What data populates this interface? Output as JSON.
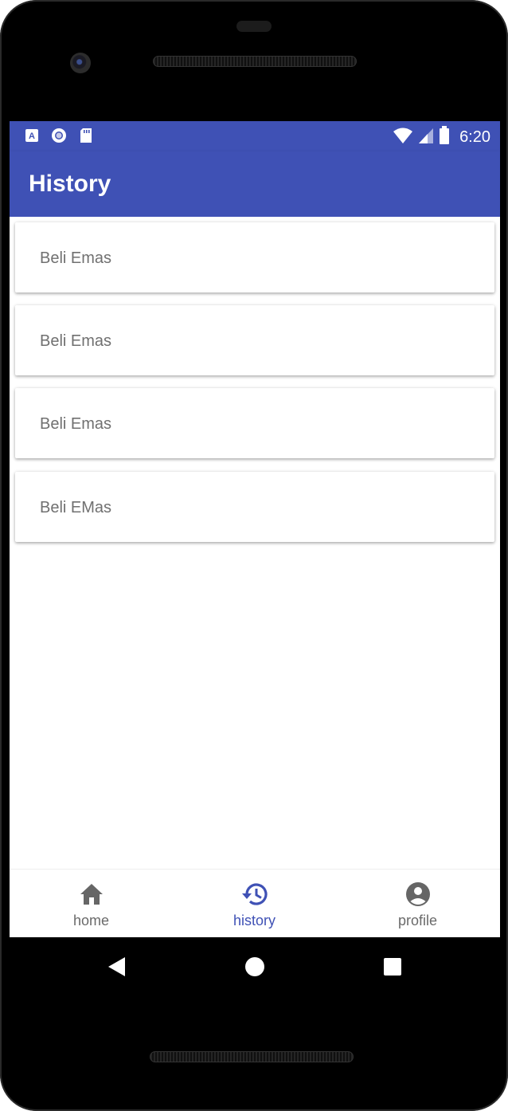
{
  "status_bar": {
    "time": "6:20",
    "left_icons": [
      "accessibility-a-icon",
      "circle-target-icon",
      "sd-card-icon"
    ],
    "right_icons": [
      "wifi-icon",
      "cell-signal-icon",
      "battery-icon"
    ]
  },
  "app_bar": {
    "title": "History"
  },
  "history": {
    "items": [
      {
        "label": "Beli Emas"
      },
      {
        "label": "Beli Emas"
      },
      {
        "label": "Beli Emas"
      },
      {
        "label": "Beli EMas"
      }
    ]
  },
  "bottom_nav": {
    "items": [
      {
        "label": "home",
        "icon": "home-icon",
        "active": false
      },
      {
        "label": "history",
        "icon": "history-icon",
        "active": true
      },
      {
        "label": "profile",
        "icon": "account-circle-icon",
        "active": false
      }
    ]
  },
  "system_nav": {
    "buttons": [
      "back-icon",
      "home-circle-icon",
      "recents-icon"
    ]
  },
  "colors": {
    "primary": "#3f51b5",
    "text_secondary": "#707070",
    "icon_inactive": "#666666"
  }
}
